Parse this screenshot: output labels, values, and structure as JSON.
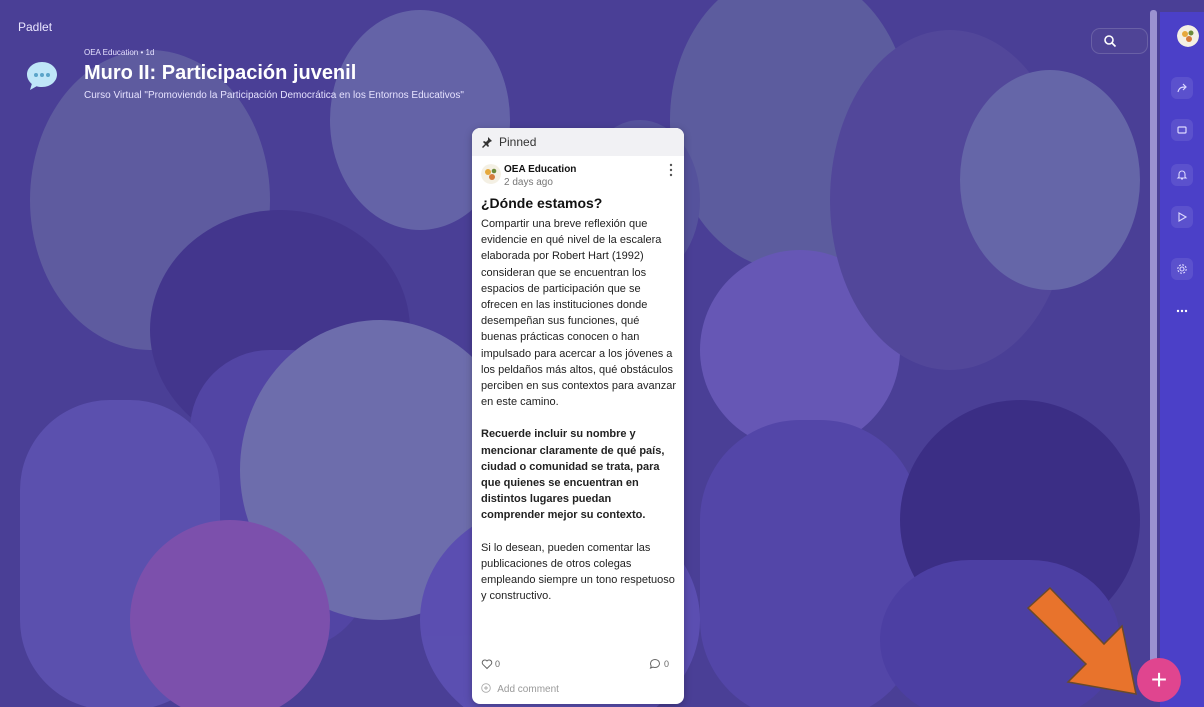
{
  "app": {
    "brand": "Padlet"
  },
  "wall": {
    "meta": "OEA Education • 1d",
    "title": "Muro II: Participación juvenil",
    "subtitle": "Curso Virtual \"Promoviendo la Participación Democrática en los Entornos Educativos\""
  },
  "toolbar": {
    "search_icon": "search-icon"
  },
  "sidebar": {
    "items": [
      {
        "icon": "share-icon"
      },
      {
        "icon": "remake-icon"
      },
      {
        "icon": "bell-icon"
      },
      {
        "icon": "play-icon"
      },
      {
        "icon": "gear-icon"
      },
      {
        "icon": "more-icon"
      }
    ]
  },
  "post": {
    "pinned_label": "Pinned",
    "author": "OEA Education",
    "time": "2 days ago",
    "title": "¿Dónde estamos?",
    "body_1": "Compartir una breve reflexión que evidencie en qué nivel de la escalera elaborada por Robert Hart (1992) consideran que se encuentran los espacios de participación que se ofrecen en las instituciones donde desempeñan sus funciones, qué buenas prácticas conocen o han impulsado para acercar a los jóvenes a los peldaños más altos, qué obstáculos perciben en sus contextos para avanzar en este camino.",
    "body_2": "Recuerde incluir su nombre y mencionar claramente de qué país, ciudad o comunidad se trata, para que quienes se encuentran en distintos lugares puedan comprender mejor su contexto.",
    "body_3": "Si lo desean, pueden comentar las publicaciones de otros colegas empleando siempre un tono respetuoso y constructivo.",
    "likes": "0",
    "comments": "0",
    "add_comment": "Add comment"
  },
  "fab": {
    "label": "+"
  },
  "colors": {
    "accent": "#e0458f",
    "sidebar": "#4b40c8",
    "background": "#4a3f96",
    "annotation_arrow": "#e8732c"
  }
}
